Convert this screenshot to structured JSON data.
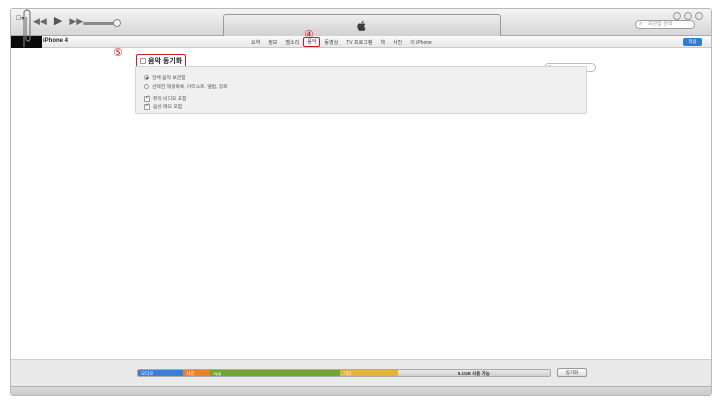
{
  "toolbar": {
    "menu_glyph": "☐▾",
    "transport": {
      "prev": "◀◀",
      "play": "▶",
      "next": "▶▶"
    },
    "volume_level": 0.9,
    "search_placeholder": "보관함 검색"
  },
  "navbar": {
    "device_name": "iPhone 4",
    "tabs": [
      "요약",
      "정보",
      "벨소리",
      "음악",
      "동영상",
      "TV 프로그램",
      "책",
      "사진",
      "이 iPhone"
    ],
    "active_tab_index": 3,
    "apply_label": "적용"
  },
  "callouts": {
    "four": "④",
    "five": "⑤"
  },
  "music_sync": {
    "title": "음악 동기화",
    "checked": false,
    "options": [
      {
        "label": "전체 음악 보관함",
        "type": "radio",
        "selected": true
      },
      {
        "label": "선택한 재생목록, 아티스트, 앨범, 장르",
        "type": "radio",
        "selected": false
      },
      {
        "label": "뮤직 비디오 포함",
        "type": "checkbox",
        "checked": true
      },
      {
        "label": "음성 메모 포함",
        "type": "checkbox",
        "checked": true
      }
    ]
  },
  "capacity": {
    "segments": [
      {
        "label": "오디오",
        "color": "#3a7fd5",
        "fraction": 0.11
      },
      {
        "label": "사진",
        "color": "#e8802c",
        "fraction": 0.065
      },
      {
        "label": "App",
        "color": "#6ea43a",
        "fraction": 0.315
      },
      {
        "label": "기타",
        "color": "#e6b13a",
        "fraction": 0.14
      },
      {
        "label": "5.1GB 사용 가능",
        "color": "#d6d6d6",
        "fraction": 0.37
      }
    ],
    "sync_label": "동기화"
  },
  "colors": {
    "highlight": "#c81d23",
    "apply_button": "#2d7dd8"
  }
}
